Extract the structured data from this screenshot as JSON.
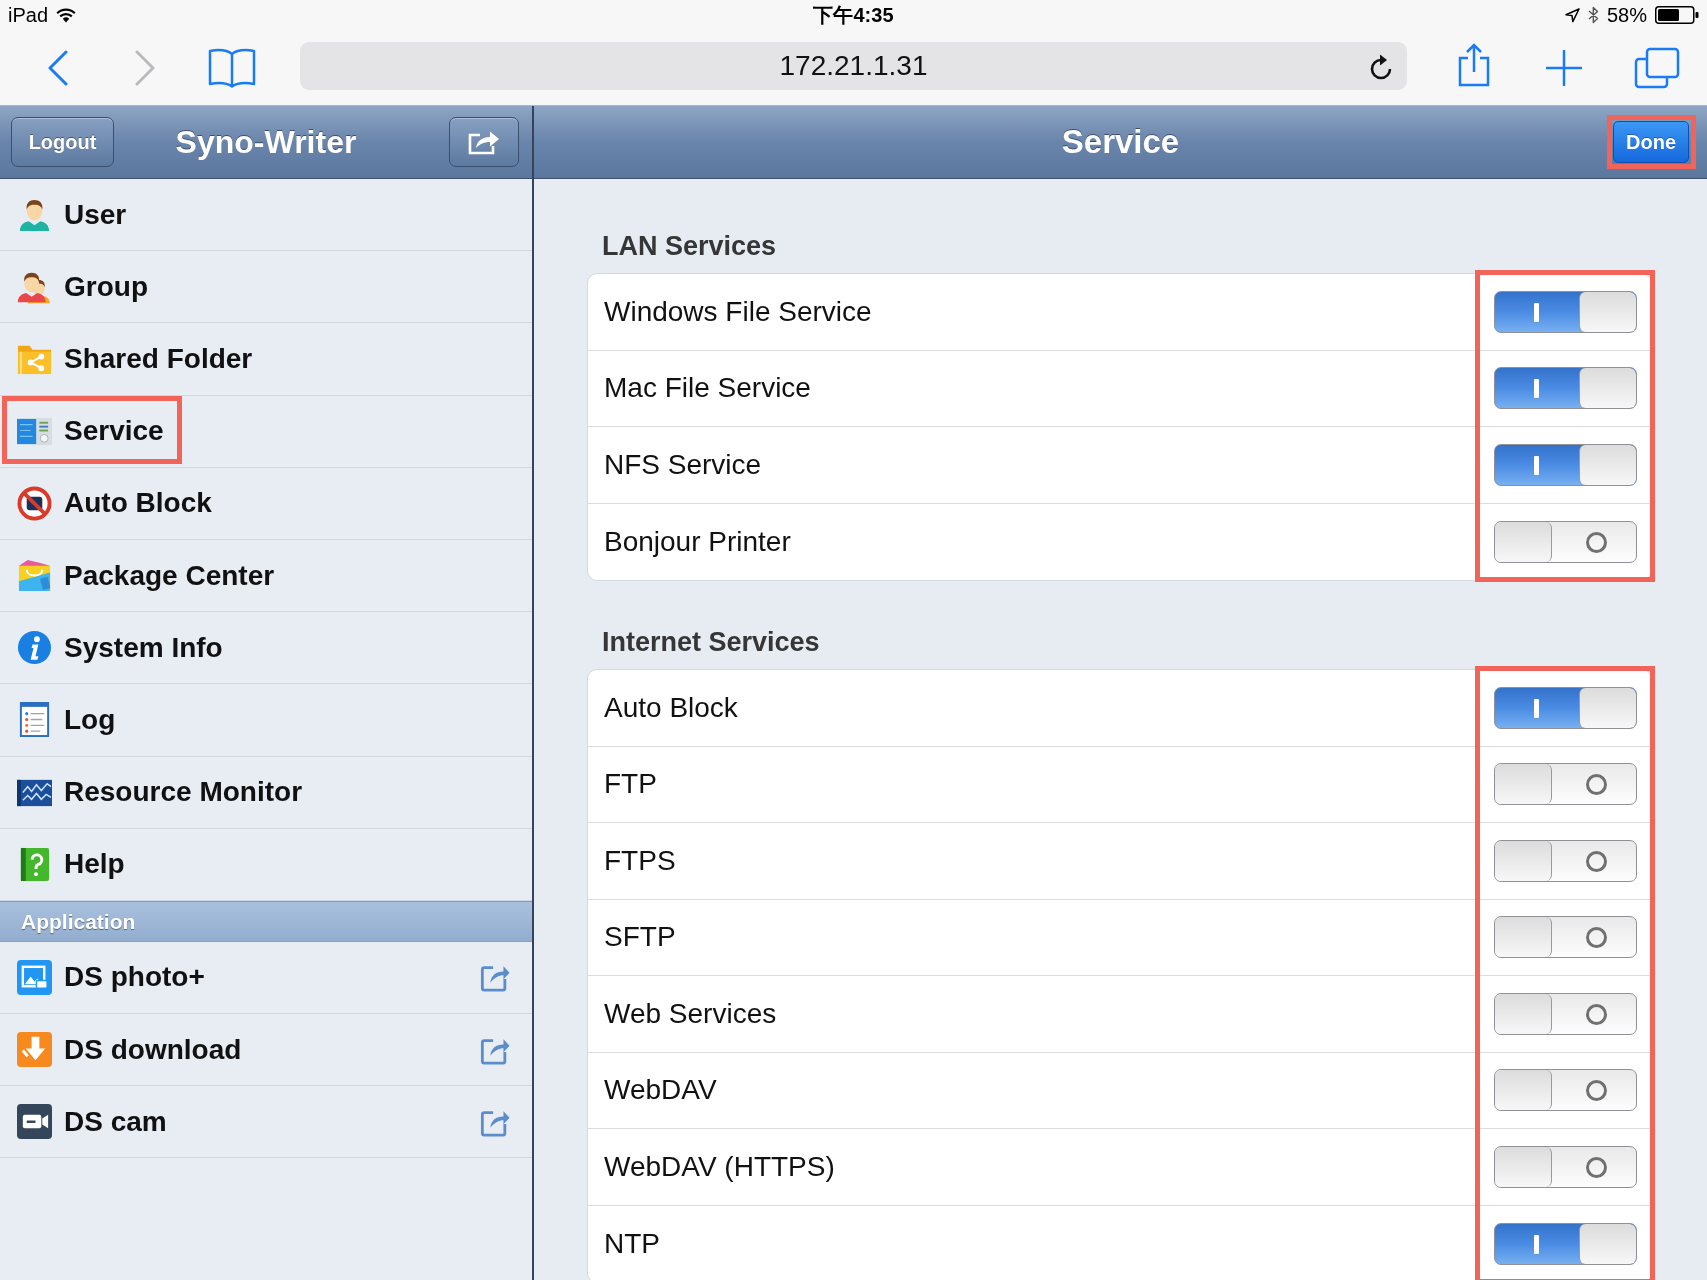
{
  "status_bar": {
    "device": "iPad",
    "time": "下午4:35",
    "battery": "58%"
  },
  "browser": {
    "nav": [
      {
        "kind": "back",
        "disabled": false
      },
      {
        "kind": "forward",
        "disabled": true
      }
    ],
    "url": "172.21.1.31"
  },
  "sidebar": {
    "logout": "Logout",
    "title": "Syno-Writer",
    "items": [
      {
        "kind": "user",
        "label": "User",
        "highlighted": false
      },
      {
        "kind": "group",
        "label": "Group",
        "highlighted": false
      },
      {
        "kind": "shared-folder",
        "label": "Shared Folder",
        "highlighted": false
      },
      {
        "kind": "service",
        "label": "Service",
        "highlighted": true
      },
      {
        "kind": "auto-block",
        "label": "Auto Block",
        "highlighted": false
      },
      {
        "kind": "package",
        "label": "Package Center",
        "highlighted": false
      },
      {
        "kind": "info",
        "label": "System Info",
        "highlighted": false
      },
      {
        "kind": "log",
        "label": "Log",
        "highlighted": false
      },
      {
        "kind": "monitor",
        "label": "Resource Monitor",
        "highlighted": false
      },
      {
        "kind": "help",
        "label": "Help",
        "highlighted": false
      }
    ],
    "groups": [
      {
        "title": "Application",
        "items": [
          {
            "kind": "photo",
            "label": "DS photo+",
            "external": true
          },
          {
            "kind": "download",
            "label": "DS download",
            "external": true
          },
          {
            "kind": "camera",
            "label": "DS cam",
            "external": true
          }
        ]
      }
    ]
  },
  "main": {
    "title": "Service",
    "done": {
      "label": "Done",
      "highlighted": true
    },
    "sections": [
      {
        "title": "LAN Services",
        "highlighted": true,
        "rows": [
          {
            "label": "Windows File Service",
            "on": true
          },
          {
            "label": "Mac File Service",
            "on": true
          },
          {
            "label": "NFS Service",
            "on": true
          },
          {
            "label": "Bonjour Printer",
            "on": false
          }
        ]
      },
      {
        "title": "Internet Services",
        "highlighted": true,
        "rows": [
          {
            "label": "Auto Block",
            "on": true
          },
          {
            "label": "FTP",
            "on": false
          },
          {
            "label": "FTPS",
            "on": false
          },
          {
            "label": "SFTP",
            "on": false
          },
          {
            "label": "Web Services",
            "on": false
          },
          {
            "label": "WebDAV",
            "on": false
          },
          {
            "label": "WebDAV (HTTPS)",
            "on": false
          },
          {
            "label": "NTP",
            "on": true
          }
        ]
      }
    ]
  }
}
